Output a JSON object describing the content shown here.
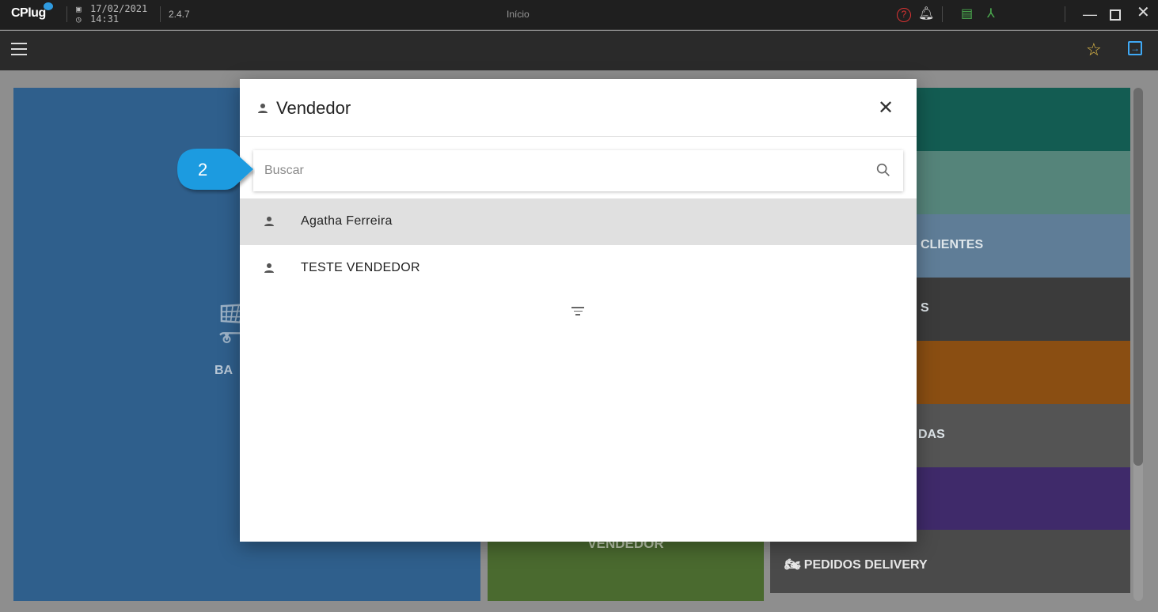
{
  "titlebar": {
    "logo": "CPlug",
    "date": "17/02/2021",
    "time": "14:31",
    "version": "2.4.7",
    "title": "Início"
  },
  "tiles": {
    "left_label": "BA",
    "green_label": "VENDEDOR",
    "right": [
      {
        "label": "",
        "color": "#135c52"
      },
      {
        "label": "",
        "color": "#55847a"
      },
      {
        "label": "CLIENTES",
        "color": "#5f7d97"
      },
      {
        "label": "S",
        "color": "#3b3b3b"
      },
      {
        "label": "",
        "color": "#8a4e12"
      },
      {
        "label": "DAS",
        "color": "#545454"
      },
      {
        "label": "",
        "color": "#3f2a6a"
      }
    ],
    "delivery_label": "PEDIDOS DELIVERY"
  },
  "modal": {
    "title": "Vendedor",
    "search_placeholder": "Buscar",
    "items": [
      {
        "label": "Agatha Ferreira",
        "selected": true
      },
      {
        "label": "TESTE VENDEDOR",
        "selected": false
      }
    ]
  },
  "callout": {
    "number": "2",
    "color": "#1e9be0"
  }
}
